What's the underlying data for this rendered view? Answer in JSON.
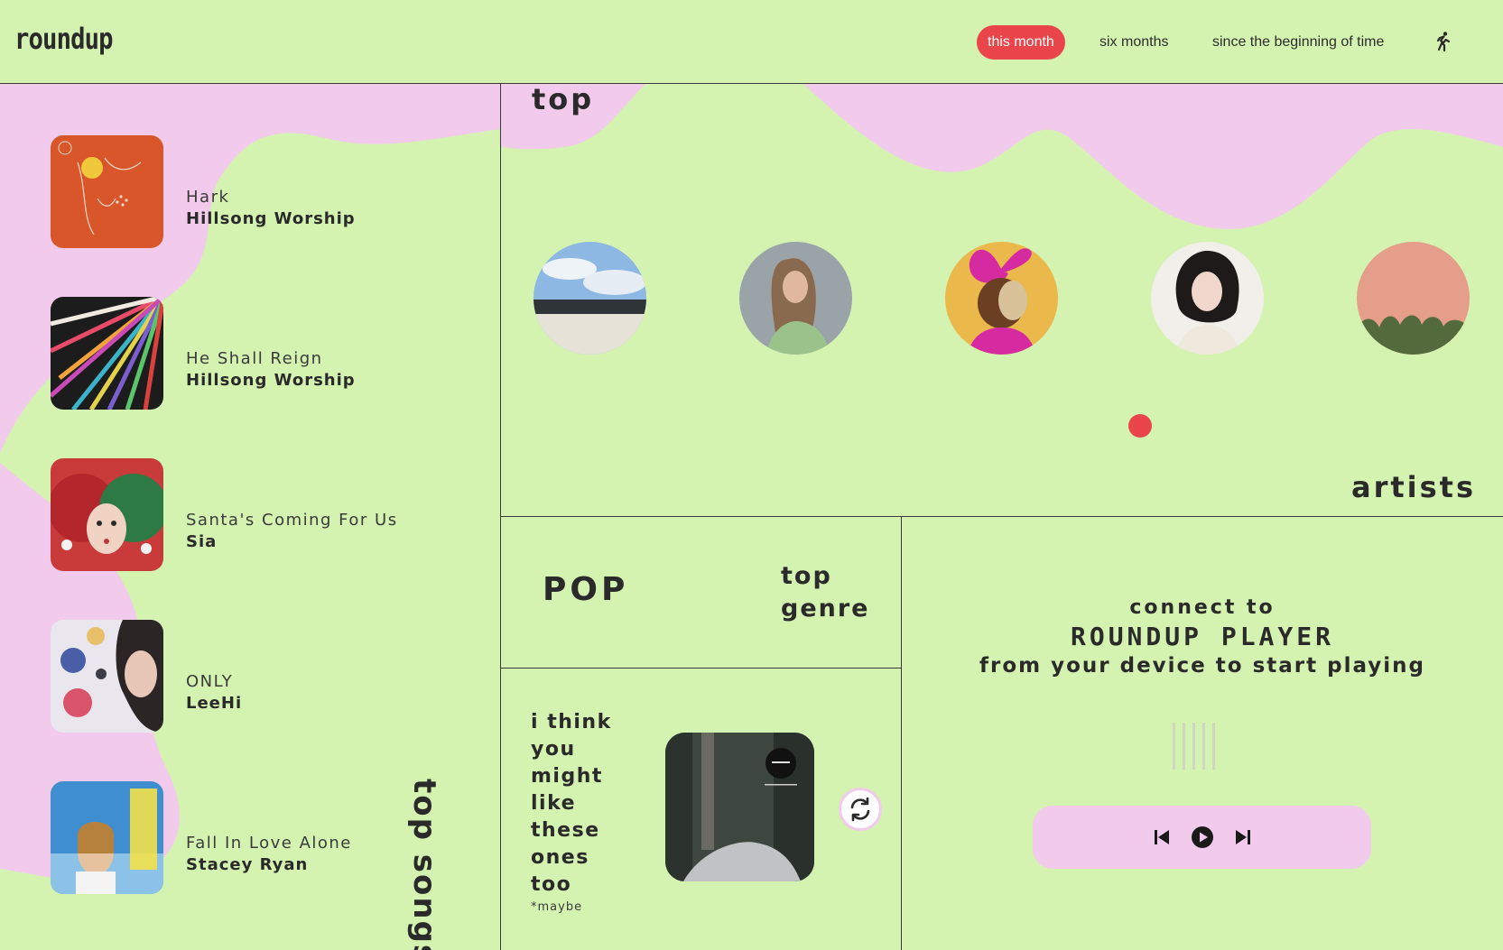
{
  "app": {
    "logo": "roundup"
  },
  "nav": {
    "ranges": [
      "this month",
      "six months",
      "since the beginning of time"
    ],
    "active_range": "this month",
    "logout_icon": "running-person-icon"
  },
  "top_songs": {
    "label": "top songs",
    "items": [
      {
        "title": "Hark",
        "artist": "Hillsong Worship"
      },
      {
        "title": "He Shall Reign",
        "artist": "Hillsong Worship"
      },
      {
        "title": "Santa's Coming For Us",
        "artist": "Sia"
      },
      {
        "title": "ONLY",
        "artist": "LeeHi"
      },
      {
        "title": "Fall In Love Alone",
        "artist": "Stacey Ryan"
      }
    ]
  },
  "top_artists": {
    "label_top": "top",
    "label_bottom": "artists",
    "count": 5
  },
  "top_genre": {
    "value": "POP",
    "label_line1": "top",
    "label_line2": "genre"
  },
  "suggestion": {
    "lines": [
      "i think",
      "you",
      "might",
      "like",
      "these",
      "ones",
      "too"
    ],
    "note": "*maybe",
    "refresh_icon": "refresh-icon"
  },
  "player": {
    "line1": "connect to",
    "name": "ROUNDUP PLAYER",
    "line2": "from your device to start playing",
    "controls": [
      "skip-previous-icon",
      "play-icon",
      "skip-next-icon"
    ]
  },
  "colors": {
    "background": "#d4f2b0",
    "accent": "#e9454a",
    "blob": "#f2cbec",
    "text": "#2a2a2a"
  }
}
